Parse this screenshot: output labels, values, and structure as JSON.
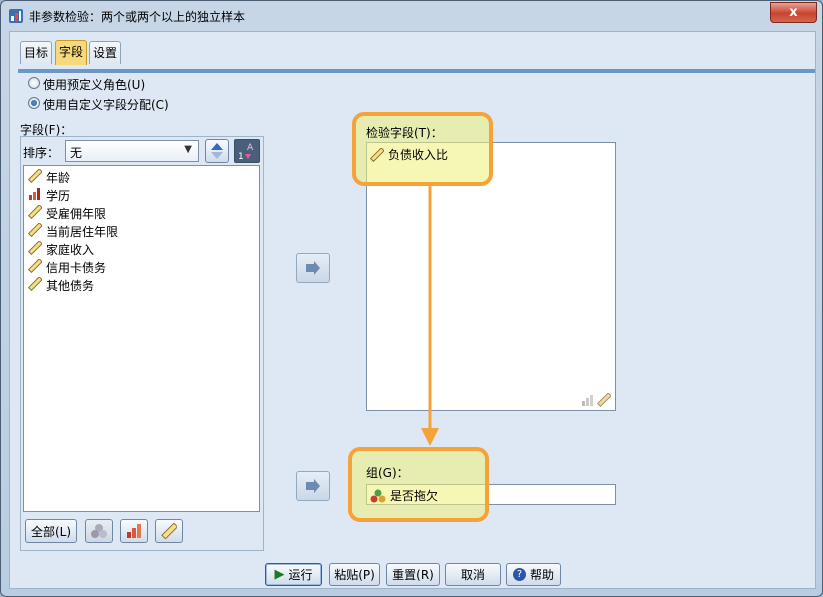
{
  "window": {
    "title": "非参数检验：两个或两个以上的独立样本",
    "close_label": "x"
  },
  "tabs": [
    {
      "label": "目标"
    },
    {
      "label": "字段"
    },
    {
      "label": "设置"
    }
  ],
  "role_options": [
    {
      "label": "使用预定义角色(U)",
      "selected": false
    },
    {
      "label": "使用自定义字段分配(C)",
      "selected": true
    }
  ],
  "fields_panel": {
    "label": "字段(F)：",
    "sort_label": "排序：",
    "sort_value": "无",
    "items": [
      {
        "label": "年龄",
        "icon": "scale-ruler-icon"
      },
      {
        "label": "学历",
        "icon": "ordinal-bar-icon"
      },
      {
        "label": "受雇佣年限",
        "icon": "scale-ruler-icon"
      },
      {
        "label": "当前居住年限",
        "icon": "scale-ruler-icon"
      },
      {
        "label": "家庭收入",
        "icon": "scale-ruler-icon"
      },
      {
        "label": "信用卡债务",
        "icon": "scale-ruler-icon"
      },
      {
        "label": "其他债务",
        "icon": "scale-ruler-icon"
      }
    ],
    "all_button": "全部(L)"
  },
  "test_fields": {
    "label": "检验字段(T)：",
    "items": [
      {
        "label": "负债收入比",
        "icon": "scale-ruler-icon"
      }
    ]
  },
  "group": {
    "label": "组(G)：",
    "value": "是否拖欠",
    "icon": "nominal-balls-icon"
  },
  "bottom_buttons": {
    "run": "运行",
    "paste": "粘贴(P)",
    "reset": "重置(R)",
    "cancel": "取消",
    "help": "帮助"
  },
  "colors": {
    "highlight_border": "#f5a23a",
    "highlight_fill": "#eef078",
    "tab_active": "#f5d97a"
  }
}
